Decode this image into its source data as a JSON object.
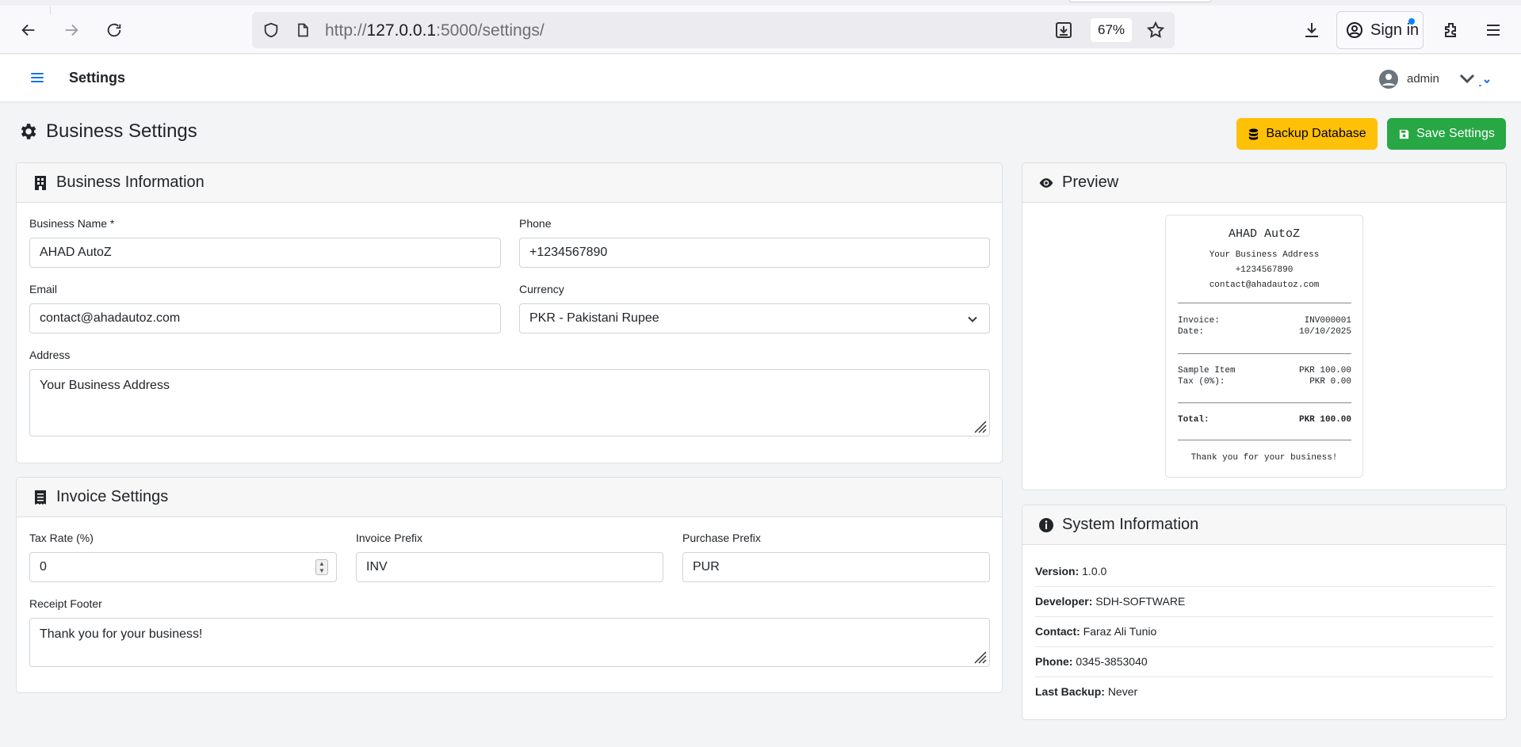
{
  "browser": {
    "url_prefix": "http://",
    "url_host": "127.0.0.1",
    "url_path": ":5000/settings/",
    "zoom": "67%",
    "sign_in_label": "Sign in"
  },
  "navbar": {
    "title": "Settings",
    "user": "admin"
  },
  "page": {
    "title": "Business Settings",
    "backup_button": "Backup Database",
    "save_button": "Save Settings"
  },
  "business_info": {
    "header": "Business Information",
    "name_label": "Business Name *",
    "name_value": "AHAD AutoZ",
    "phone_label": "Phone",
    "phone_value": "+1234567890",
    "email_label": "Email",
    "email_value": "contact@ahadautoz.com",
    "currency_label": "Currency",
    "currency_value": "PKR - Pakistani Rupee",
    "address_label": "Address",
    "address_value": "Your Business Address"
  },
  "invoice_settings": {
    "header": "Invoice Settings",
    "tax_label": "Tax Rate (%)",
    "tax_value": "0",
    "invoice_prefix_label": "Invoice Prefix",
    "invoice_prefix_value": "INV",
    "purchase_prefix_label": "Purchase Prefix",
    "purchase_prefix_value": "PUR",
    "footer_label": "Receipt Footer",
    "footer_value": "Thank you for your business!"
  },
  "preview": {
    "header": "Preview",
    "business_name": "AHAD AutoZ",
    "address": "Your Business Address",
    "phone": "+1234567890",
    "email": "contact@ahadautoz.com",
    "invoice_label": "Invoice:",
    "invoice_value": "INV000001",
    "date_label": "Date:",
    "date_value": "10/10/2025",
    "item_label": "Sample Item",
    "item_value": "PKR 100.00",
    "tax_label": "Tax (0%):",
    "tax_value": "PKR 0.00",
    "total_label": "Total:",
    "total_value": "PKR 100.00",
    "footer": "Thank you for your business!"
  },
  "system_info": {
    "header": "System Information",
    "rows": [
      {
        "label": "Version:",
        "value": "1.0.0"
      },
      {
        "label": "Developer:",
        "value": "SDH-SOFTWARE"
      },
      {
        "label": "Contact:",
        "value": "Faraz Ali Tunio"
      },
      {
        "label": "Phone:",
        "value": "0345-3853040"
      },
      {
        "label": "Last Backup:",
        "value": "Never"
      }
    ]
  },
  "colors": {
    "warning": "#ffc107",
    "success": "#28a745",
    "accent": "#1a73e8"
  }
}
